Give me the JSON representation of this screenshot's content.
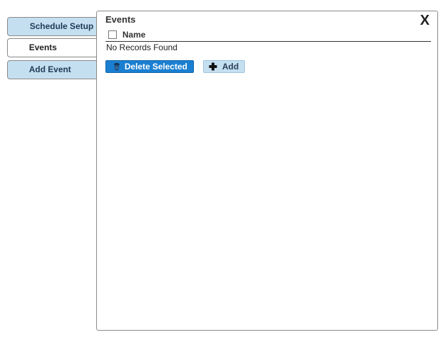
{
  "tabs": {
    "schedule_setup": "Schedule Setup",
    "events": "Events",
    "add_event": "Add Event"
  },
  "panel": {
    "title": "Events",
    "close_label": "X",
    "columns": [
      "Name"
    ],
    "empty_message": "No Records Found",
    "actions": {
      "delete_label": "Delete Selected",
      "add_label": "Add"
    }
  },
  "colors": {
    "tab_inactive_bg": "#c4dff0",
    "primary_button": "#1a7fd1",
    "secondary_button": "#c4dff0"
  },
  "icons": {
    "delete": "trash-icon",
    "add": "plus-icon",
    "close": "close-icon"
  }
}
